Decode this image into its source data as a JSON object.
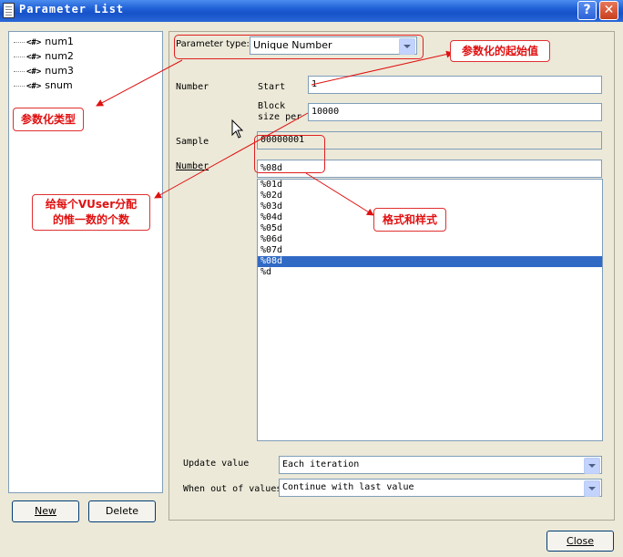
{
  "window": {
    "title": "Parameter List",
    "help_label": "?",
    "close_label": "✕"
  },
  "tree": {
    "items": [
      {
        "tag": "<#>",
        "label": "num1"
      },
      {
        "tag": "<#>",
        "label": "num2"
      },
      {
        "tag": "<#>",
        "label": "num3"
      },
      {
        "tag": "<#>",
        "label": "snum"
      }
    ]
  },
  "left_buttons": {
    "new_label": "New",
    "delete_label": "Delete"
  },
  "form": {
    "param_type_label": "Parameter type:",
    "param_type_value": "Unique Number",
    "number_group_label": "Number",
    "start_label": "Start",
    "start_value": "1",
    "block_label_line1": "Block",
    "block_label_line2": "size per",
    "block_value": "10000",
    "sample_label": "Sample",
    "sample_value": "00000001",
    "number_format_label": "Number",
    "number_format_value": "%08d",
    "formats": [
      "%01d",
      "%02d",
      "%03d",
      "%04d",
      "%05d",
      "%06d",
      "%07d",
      "%08d",
      "%d"
    ],
    "selected_format": "%08d",
    "update_label": "Update value",
    "update_value": "Each iteration",
    "out_of_values_label": "When out of values",
    "out_of_values_value": "Continue with last value"
  },
  "footer": {
    "close_label": "Close"
  },
  "annotations": {
    "param_type": "参数化类型",
    "start_value": "参数化的起始值",
    "block_size": "给每个VUser分配\n的惟一数的个数",
    "format": "格式和样式"
  },
  "colors": {
    "title_bar": "#1f5fd6",
    "annotation_red": "#e01010",
    "selection": "#316ac5"
  }
}
